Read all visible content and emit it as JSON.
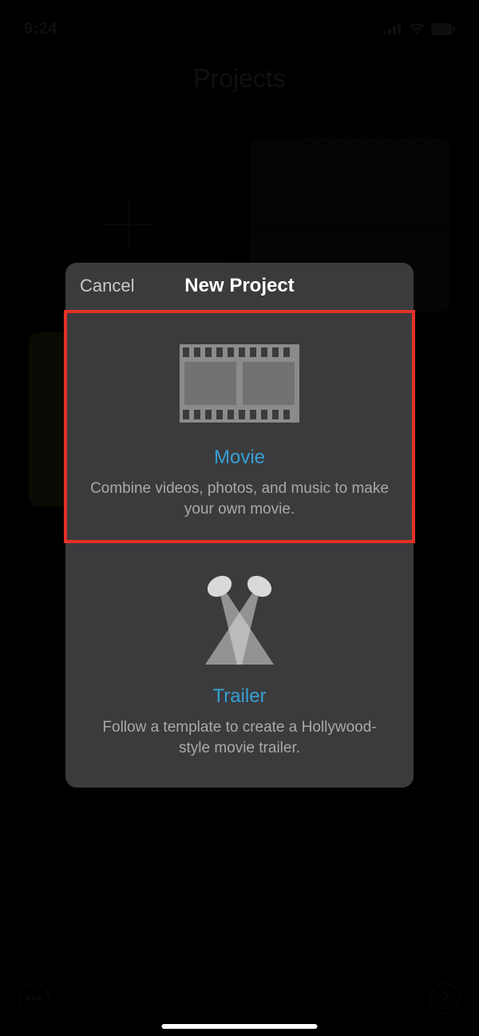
{
  "status": {
    "time": "9:24"
  },
  "header": {
    "title": "Projects"
  },
  "sheet": {
    "cancel": "Cancel",
    "title": "New Project",
    "movie": {
      "label": "Movie",
      "desc": "Combine videos, photos, and music to make your own movie."
    },
    "trailer": {
      "label": "Trailer",
      "desc": "Follow a template to create a Hollywood-style movie trailer."
    }
  },
  "footer": {
    "more": "•••",
    "help": "?"
  }
}
